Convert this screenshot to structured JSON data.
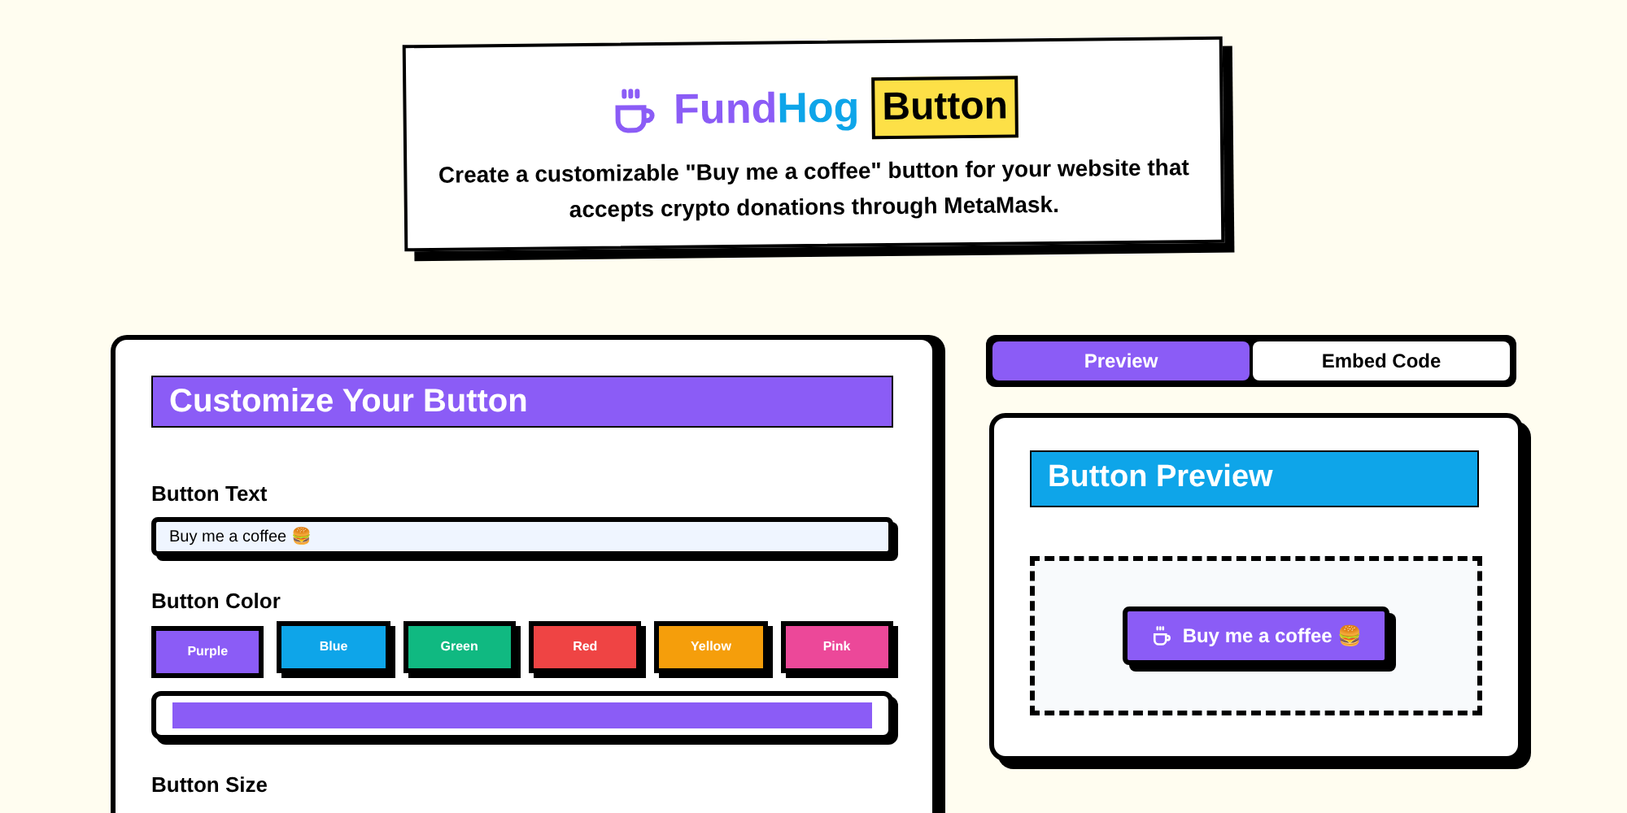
{
  "header": {
    "brand_first": "Fund",
    "brand_second": "Hog",
    "badge": "Button",
    "description": "Create a customizable \"Buy me a coffee\" button for your website that accepts crypto donations through MetaMask."
  },
  "customize": {
    "title": "Customize Your Button",
    "text_label": "Button Text",
    "text_value": "Buy me a coffee 🍔",
    "color_label": "Button Color",
    "colors": [
      {
        "label": "Purple",
        "color": "#8b5cf6",
        "selected": true
      },
      {
        "label": "Blue",
        "color": "#0ea5e9",
        "selected": false
      },
      {
        "label": "Green",
        "color": "#10b981",
        "selected": false
      },
      {
        "label": "Red",
        "color": "#ef4444",
        "selected": false
      },
      {
        "label": "Yellow",
        "color": "#f59e0b",
        "selected": false
      },
      {
        "label": "Pink",
        "color": "#ec4899",
        "selected": false
      }
    ],
    "size_label": "Button Size"
  },
  "tabs": [
    {
      "label": "Preview",
      "selected": true
    },
    {
      "label": "Embed Code",
      "selected": false
    }
  ],
  "preview": {
    "title": "Button Preview",
    "button_label": "Buy me a coffee 🍔"
  }
}
